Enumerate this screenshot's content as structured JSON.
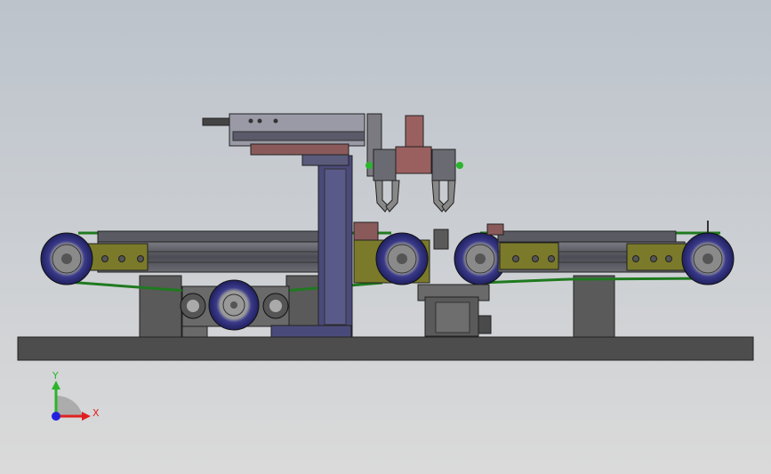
{
  "triad": {
    "y_label": "Y",
    "x_label": "X",
    "y_color": "#2bb52b",
    "x_color": "#e02020",
    "z_color": "#2222dd"
  },
  "colors": {
    "background_top": "#bcc3cb",
    "background_bottom": "#dadada",
    "base_plate": "#4d4d4d",
    "belt_green": "#1f7a1f",
    "pulley_blue": "#2a2a7a",
    "bracket_olive": "#7a7a2a",
    "extrusion_gray": "#5e5e66",
    "column_blue": "#4a4a7a",
    "gripper_rose": "#9a6060",
    "motor_gray": "#5a5a5a"
  }
}
